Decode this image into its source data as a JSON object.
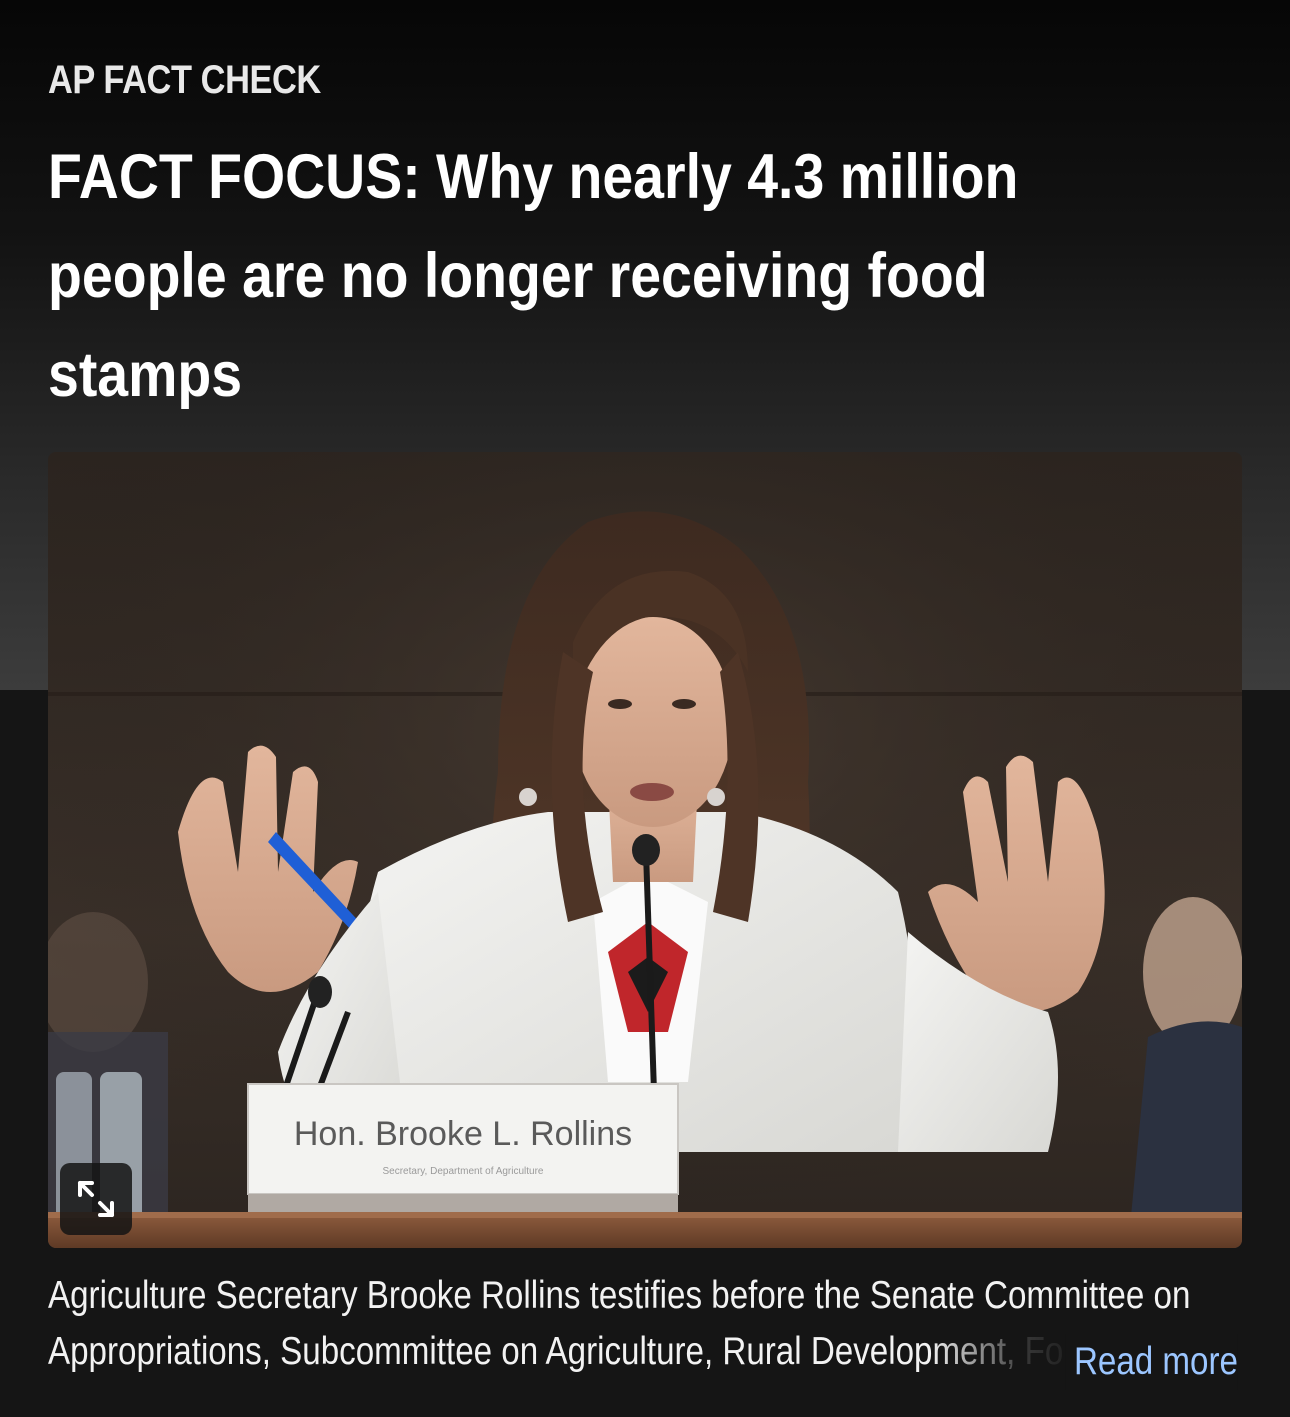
{
  "article": {
    "kicker": "AP FACT CHECK",
    "headline": "FACT FOCUS: Why nearly 4.3 million people are no longer receiving food stamps"
  },
  "photo": {
    "nameplate_name": "Hon. Brooke L. Rollins",
    "nameplate_title": "Secretary, Department of Agriculture",
    "expand_icon": "expand-arrows-icon"
  },
  "caption": {
    "line1": "Agriculture Secretary Brooke Rollins testifies before the Senate Committee on",
    "line2": "Appropriations, Subcommittee on Agriculture, Rural Development, Fo",
    "read_more": "Read more"
  },
  "colors": {
    "background": "#151515",
    "link": "#9cc6ff",
    "text": "#ffffff"
  }
}
